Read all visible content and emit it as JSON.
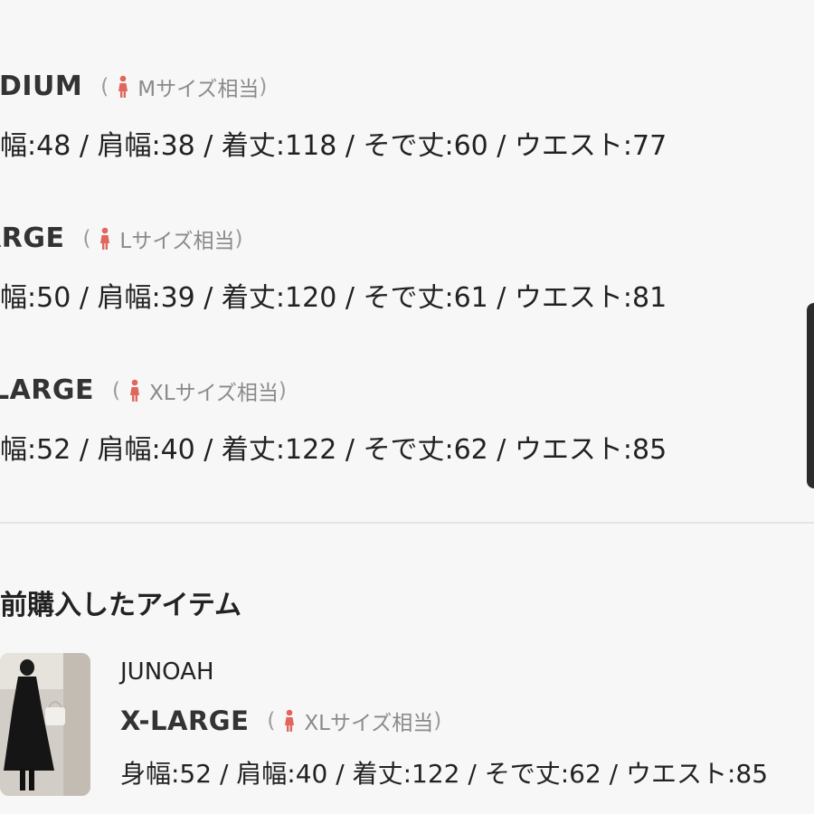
{
  "sizes": [
    {
      "name_visible": "EDIUM",
      "equiv_open": "(",
      "equiv_text": "Mサイズ相当",
      "equiv_close": ")",
      "measurements_visible": "幅:48 / 肩幅:38 / 着丈:118 / そで丈:60 / ウエスト:77"
    },
    {
      "name_visible": "ARGE",
      "equiv_open": "(",
      "equiv_text": "Lサイズ相当",
      "equiv_close": ")",
      "measurements_visible": "幅:50 / 肩幅:39 / 着丈:120 / そで丈:61 / ウエスト:81"
    },
    {
      "name_visible": "-LARGE",
      "equiv_open": "(",
      "equiv_text": "XLサイズ相当",
      "equiv_close": ")",
      "measurements_visible": "幅:52 / 肩幅:40 / 着丈:122 / そで丈:62 / ウエスト:85"
    }
  ],
  "past_purchases": {
    "title_visible": "前購入したアイテム",
    "item": {
      "brand": "JUNOAH",
      "size_name": "X-LARGE",
      "equiv_open": "(",
      "equiv_text": "XLサイズ相当",
      "equiv_close": ")",
      "measurements": "身幅:52 / 肩幅:40 / 着丈:122 / そで丈:62 / ウエスト:85"
    }
  },
  "colors": {
    "person_icon": "#e0665e",
    "background": "#f7f7f7",
    "text": "#222222",
    "muted_text": "#8a8a8a"
  },
  "icons": {
    "person": "female-figure-icon"
  }
}
